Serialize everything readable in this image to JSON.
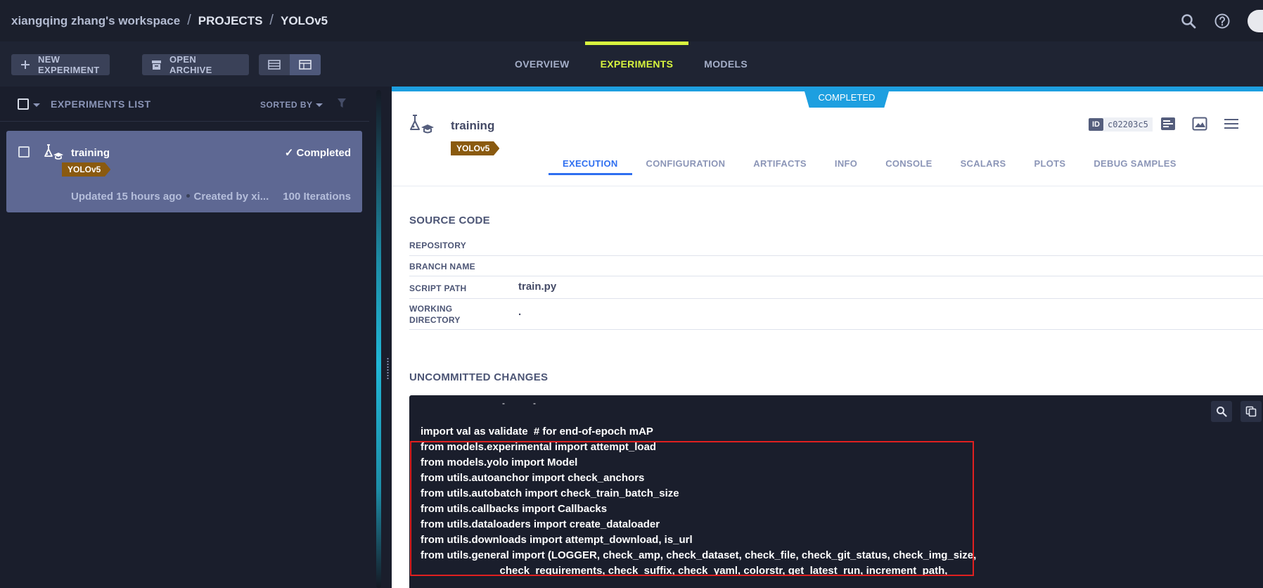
{
  "breadcrumb": {
    "workspace": "xiangqing zhang's workspace",
    "separator": "/",
    "projects": "PROJECTS",
    "project": "YOLOv5"
  },
  "header_icons": [
    "search-icon",
    "help-icon",
    "avatar"
  ],
  "toolbar": {
    "new_experiment": "NEW EXPERIMENT",
    "open_archive": "OPEN ARCHIVE"
  },
  "top_tabs": [
    {
      "label": "OVERVIEW",
      "active": false
    },
    {
      "label": "EXPERIMENTS",
      "active": true
    },
    {
      "label": "MODELS",
      "active": false
    }
  ],
  "experiments_list": {
    "title": "EXPERIMENTS LIST",
    "sorted_by": "SORTED BY",
    "items": [
      {
        "name": "training",
        "status": "Completed",
        "tag": "YOLOv5",
        "updated": "Updated 15 hours ago",
        "created": "Created by xi...",
        "iterations": "100 Iterations"
      }
    ]
  },
  "detail": {
    "status_ribbon": "COMPLETED",
    "title": "training",
    "tag": "YOLOv5",
    "id_label": "ID",
    "id_value": "c02203c5",
    "tabs": [
      {
        "label": "EXECUTION",
        "active": true
      },
      {
        "label": "CONFIGURATION",
        "active": false
      },
      {
        "label": "ARTIFACTS",
        "active": false
      },
      {
        "label": "INFO",
        "active": false
      },
      {
        "label": "CONSOLE",
        "active": false
      },
      {
        "label": "SCALARS",
        "active": false
      },
      {
        "label": "PLOTS",
        "active": false
      },
      {
        "label": "DEBUG SAMPLES",
        "active": false
      }
    ],
    "source_code": {
      "title": "SOURCE CODE",
      "repository_label": "REPOSITORY",
      "repository_value": "",
      "branch_label": "BRANCH NAME",
      "branch_value": "",
      "script_label": "SCRIPT PATH",
      "script_value": "train.py",
      "workdir_label_1": "WORKING",
      "workdir_label_2": "DIRECTORY",
      "workdir_value": "."
    },
    "uncommitted": {
      "title": "UNCOMMITTED CHANGES",
      "lines": [
        "import val as validate  # for end-of-epoch mAP",
        "from models.experimental import attempt_load",
        "from models.yolo import Model",
        "from utils.autoanchor import check_anchors",
        "from utils.autobatch import check_train_batch_size",
        "from utils.callbacks import Callbacks",
        "from utils.dataloaders import create_dataloader",
        "from utils.downloads import attempt_download, is_url",
        "from utils.general import (LOGGER, check_amp, check_dataset, check_file, check_git_status, check_img_size,",
        "                           check_requirements, check_suffix, check_yaml, colorstr, get_latest_run, increment_path,"
      ]
    }
  },
  "colors": {
    "accent": "#d8f53e",
    "status_blue": "#1d9fe0",
    "tag_brown": "#8a5a0f",
    "highlight_red": "#e02020"
  }
}
